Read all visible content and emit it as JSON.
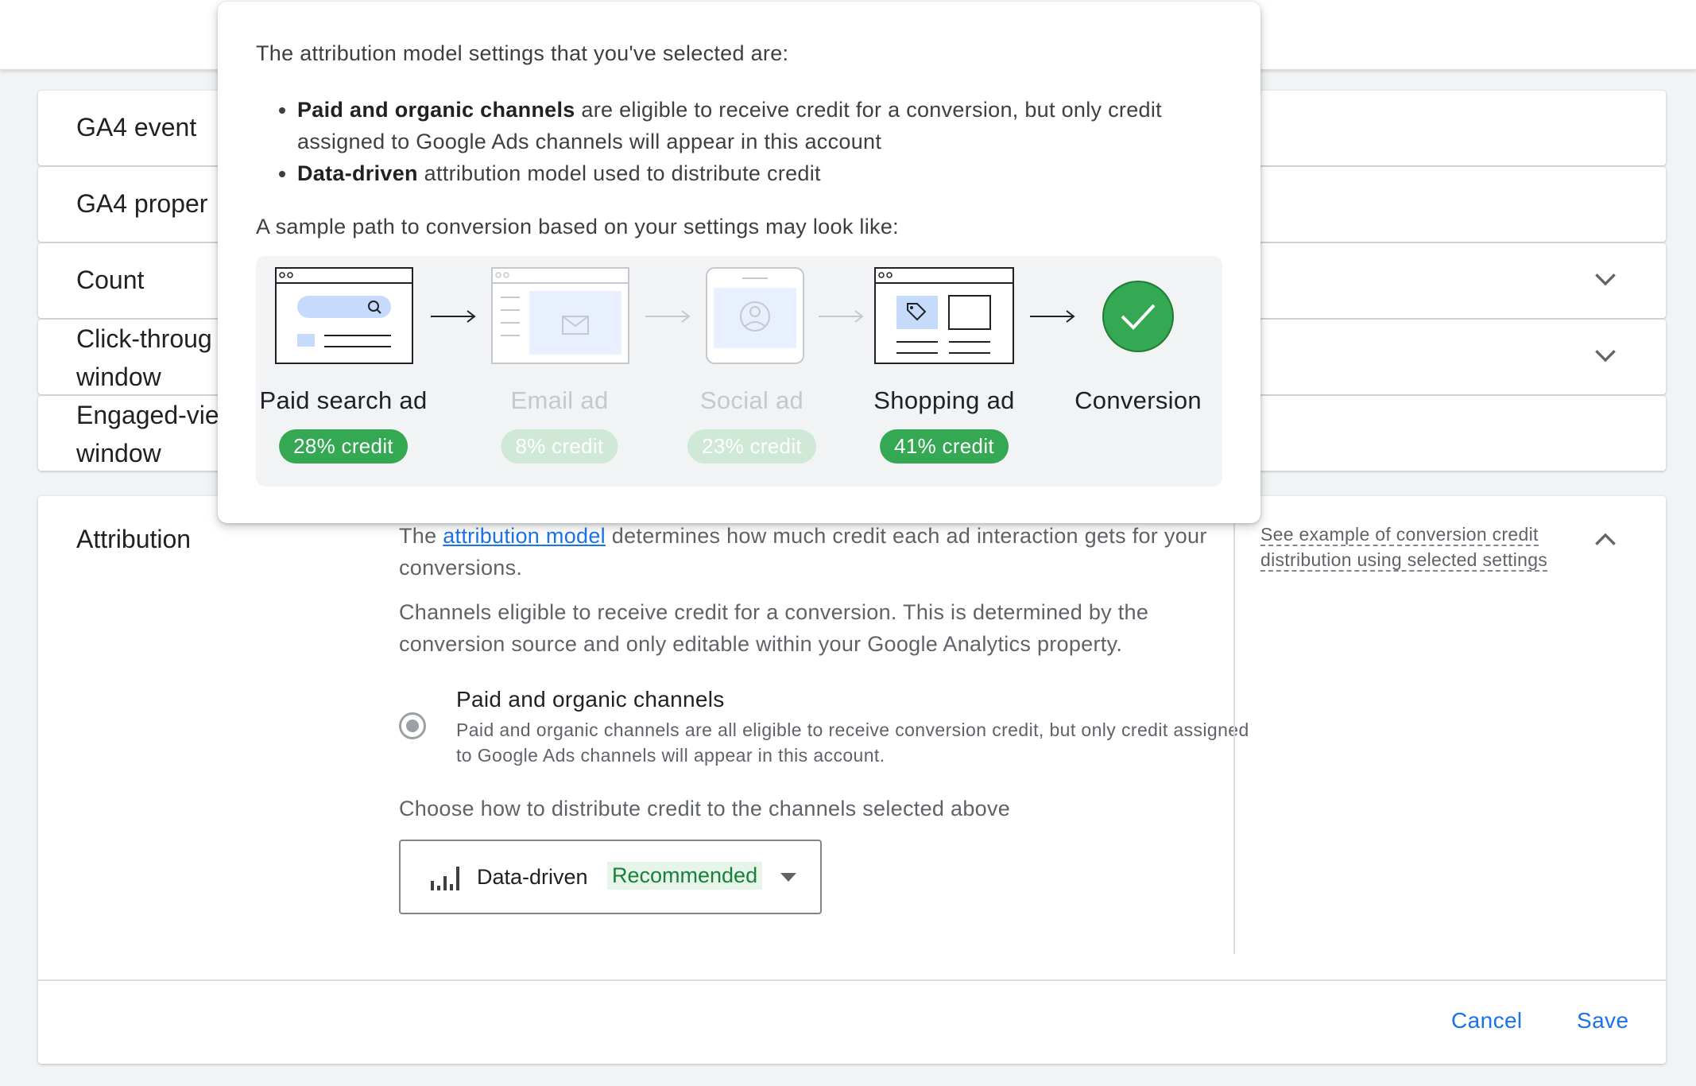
{
  "rows": [
    {
      "label": "GA4 event"
    },
    {
      "label": "GA4 proper"
    },
    {
      "label": "Count"
    },
    {
      "label": "Click-throug\nwindow"
    },
    {
      "label": "Engaged-vie\nwindow"
    }
  ],
  "attribution": {
    "title": "Attribution",
    "desc_prefix": "The ",
    "desc_link": "attribution model",
    "desc_suffix": " determines how much credit each ad interaction gets for your conversions.",
    "channels_desc": "Channels eligible to receive credit for a conversion. This is determined by the conversion source and only editable within your Google Analytics property.",
    "radio_title": "Paid and organic channels",
    "radio_sub": "Paid and organic channels are all eligible to receive conversion credit, but only credit assigned to Google Ads channels will appear in this account.",
    "choose_label": "Choose how to distribute credit to the channels selected above",
    "dropdown_value": "Data-driven",
    "dropdown_badge": "Recommended",
    "see_example": "See example of conversion credit distribution using selected settings",
    "cancel": "Cancel",
    "save": "Save"
  },
  "popover": {
    "intro": "The attribution model settings that you've selected are:",
    "bullet1_bold": "Paid and organic channels",
    "bullet1_rest": " are eligible to receive credit for a conversion, but only credit assigned to Google Ads channels will appear in this account",
    "bullet2_bold": "Data-driven",
    "bullet2_rest": " attribution model used to distribute credit",
    "sample": "A sample path to conversion based on your settings may look like:",
    "steps": [
      {
        "label": "Paid search ad",
        "credit": "28% credit",
        "icon": "search-ad-icon"
      },
      {
        "label": "Email ad",
        "credit": "8% credit",
        "icon": "email-ad-icon"
      },
      {
        "label": "Social ad",
        "credit": "23% credit",
        "icon": "social-ad-icon"
      },
      {
        "label": "Shopping ad",
        "credit": "41% credit",
        "icon": "shopping-ad-icon"
      },
      {
        "label": "Conversion",
        "icon": "checkmark-icon"
      }
    ]
  },
  "colors": {
    "accent": "#1a73e8",
    "credit_green": "#34a853",
    "conversion_green": "#34a853"
  }
}
